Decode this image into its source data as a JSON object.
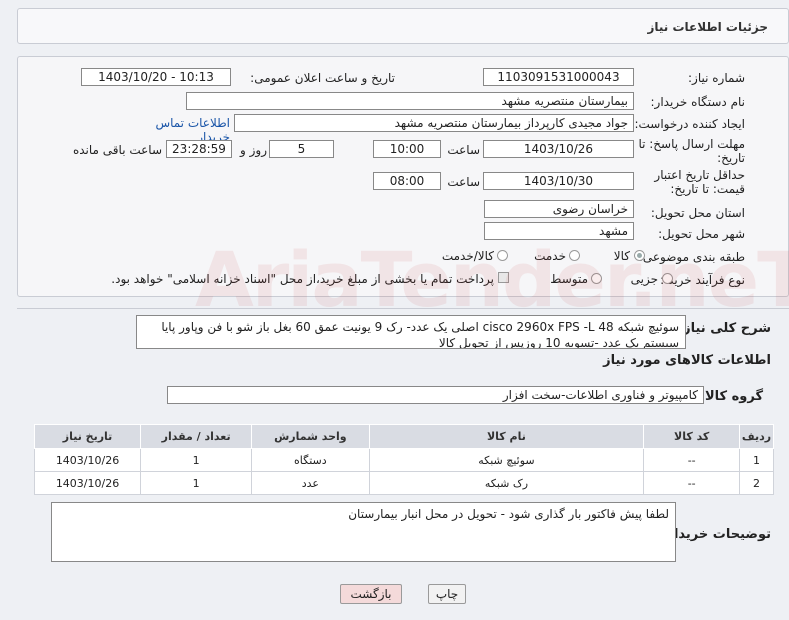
{
  "header": {
    "title": "جزئیات اطلاعات نیاز"
  },
  "form": {
    "need_number_label": "شماره نیاز:",
    "need_number": "1103091531000043",
    "announce_label": "تاریخ و ساعت اعلان عمومی:",
    "announce_value": "1403/10/20 - 10:13",
    "buyer_org_label": "نام دستگاه خریدار:",
    "buyer_org": "بیمارستان منتصریه مشهد",
    "creator_label": "ایجاد کننده درخواست:",
    "creator": "جواد مجیدی کارپرداز بیمارستان منتصریه مشهد",
    "contact_link": "اطلاعات تماس خریدار",
    "deadline_label": "مهلت ارسال پاسخ: تا تاریخ:",
    "deadline_date": "1403/10/26",
    "time_label": "ساعت",
    "deadline_time": "10:00",
    "days_value": "5",
    "days_label": "روز و",
    "remaining_time": "23:28:59",
    "remaining_label": "ساعت باقی مانده",
    "validity_label": "حداقل تاریخ اعتبار قیمت: تا تاریخ:",
    "validity_date": "1403/10/30",
    "validity_time": "08:00",
    "province_label": "استان محل تحویل:",
    "province": "خراسان رضوی",
    "city_label": "شهر محل تحویل:",
    "city": "مشهد",
    "category_label": "طبقه بندی موضوعی:",
    "category_options": [
      "کالا",
      "خدمت",
      "کالا/خدمت"
    ],
    "category_selected": "کالا",
    "process_label": "نوع فرآیند خرید :",
    "process_options": [
      "جزیی",
      "متوسط"
    ],
    "process_note": "پرداخت تمام یا بخشی از مبلغ خرید،از محل \"اسناد خزانه اسلامی\" خواهد بود."
  },
  "description": {
    "label": "شرح کلی نیاز:",
    "text": "سوئیچ شبکه cisco 2960x FPS -L 48 اصلی یک عدد- رک 9 یونیت عمق 60 بغل باز شو با فن وپاور پایا سیستم یک عدد -تسویه 10 روزپس از تحویل کالا"
  },
  "goods_info": {
    "title": "اطلاعات کالاهای مورد نیاز",
    "group_label": "گروه کالا:",
    "group_value": "کامپیوتر و فناوری اطلاعات-سخت افزار"
  },
  "table": {
    "headers": [
      "ردیف",
      "کد کالا",
      "نام کالا",
      "واحد شمارش",
      "تعداد / مقدار",
      "تاریخ نیاز"
    ],
    "rows": [
      [
        "1",
        "--",
        "سوئیچ شبکه",
        "دستگاه",
        "1",
        "1403/10/26"
      ],
      [
        "2",
        "--",
        "رک شبکه",
        "عدد",
        "1",
        "1403/10/26"
      ]
    ]
  },
  "buyer_notes": {
    "label": "توضیحات خریدار:",
    "text": "لطفا پیش فاکتور بار گذاری شود -  تحویل در محل انبار بیمارستان"
  },
  "buttons": {
    "print": "چاپ",
    "back": "بازگشت"
  },
  "colors": {
    "back_button": "#f4dada",
    "print_button": "#f2f2f2",
    "link": "#1a55a8"
  },
  "watermark": "AriaTender.neT"
}
